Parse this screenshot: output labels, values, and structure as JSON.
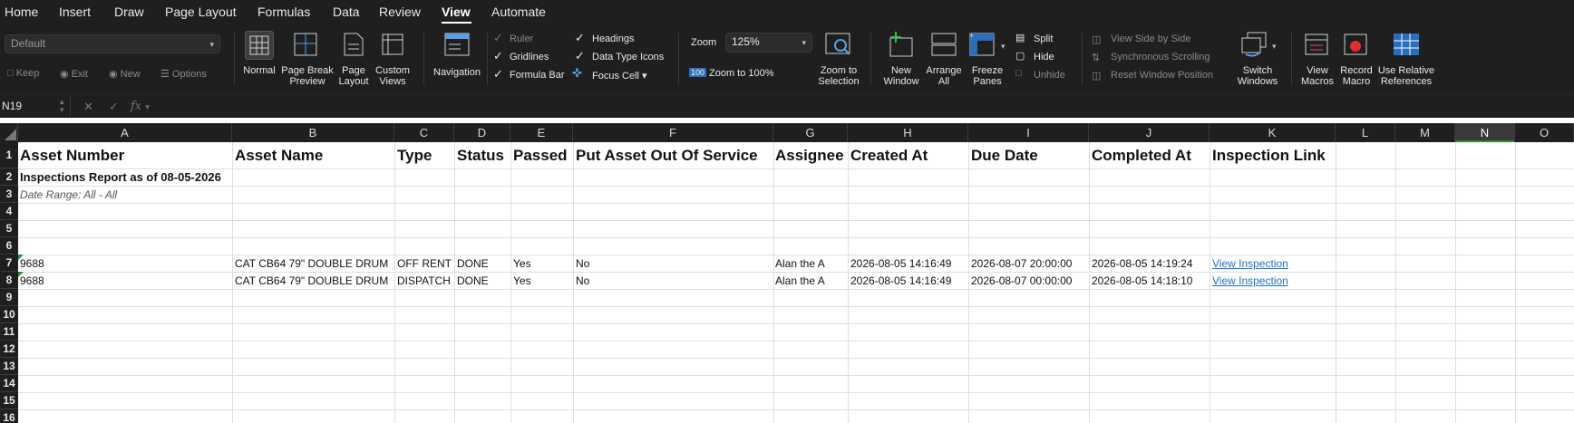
{
  "menu": {
    "tabs": [
      "Home",
      "Insert",
      "Draw",
      "Page Layout",
      "Formulas",
      "Data",
      "Review",
      "View",
      "Automate"
    ],
    "active": "View"
  },
  "ribbon": {
    "views_dropdown": "Default",
    "sheet_view_actions": [
      "Keep",
      "Exit",
      "New",
      "Options"
    ],
    "workbook_views": {
      "normal": "Normal",
      "page_break_1": "Page Break",
      "page_break_2": "Preview",
      "page_layout_1": "Page",
      "page_layout_2": "Layout",
      "custom_1": "Custom",
      "custom_2": "Views"
    },
    "navigation": "Navigation",
    "show": {
      "ruler": "Ruler",
      "gridlines": "Gridlines",
      "formula_bar": "Formula Bar",
      "headings": "Headings",
      "data_type_icons": "Data Type Icons",
      "focus_cell": "Focus Cell"
    },
    "zoom": {
      "label": "Zoom",
      "value": "125%",
      "zoom100": "Zoom to 100%",
      "badge": "100",
      "zoom_sel_1": "Zoom to",
      "zoom_sel_2": "Selection"
    },
    "window": {
      "new_1": "New",
      "new_2": "Window",
      "arrange_1": "Arrange",
      "arrange_2": "All",
      "freeze_1": "Freeze",
      "freeze_2": "Panes",
      "split": "Split",
      "hide": "Hide",
      "unhide": "Unhide"
    },
    "compare": {
      "side_by_side": "View Side by Side",
      "sync_scroll": "Synchronous Scrolling",
      "reset": "Reset Window Position"
    },
    "switch_1": "Switch",
    "switch_2": "Windows",
    "macros": {
      "view_1": "View",
      "view_2": "Macros",
      "record_1": "Record",
      "record_2": "Macro",
      "relative_1": "Use Relative",
      "relative_2": "References"
    }
  },
  "formula_bar": {
    "name_box": "N19",
    "fx": "fx",
    "value": ""
  },
  "grid": {
    "columns": [
      "A",
      "B",
      "C",
      "D",
      "E",
      "F",
      "G",
      "H",
      "I",
      "J",
      "K",
      "L",
      "M",
      "N",
      "O"
    ],
    "selected_column": "N",
    "rows": [
      "1",
      "2",
      "3",
      "4",
      "5",
      "6",
      "7",
      "8",
      "9",
      "10",
      "11",
      "12",
      "13",
      "14",
      "15",
      "16"
    ],
    "headers": [
      "Asset Number",
      "Asset Name",
      "Type",
      "Status",
      "Passed",
      "Put Asset Out Of Service",
      "Assignee",
      "Created At",
      "Due Date",
      "Completed At",
      "Inspection Link"
    ],
    "report_title": "Inspections Report as of 08-05-2026",
    "date_range": "Date Range: All - All",
    "records": [
      [
        "9688",
        "CAT CB64 79\" DOUBLE DRUM",
        "OFF RENT",
        "DONE",
        "Yes",
        "No",
        "Alan the A",
        "2026-08-05 14:16:49",
        "2026-08-07 20:00:00",
        "2026-08-05 14:19:24",
        "View Inspection"
      ],
      [
        "9688",
        "CAT CB64 79\" DOUBLE DRUM",
        "DISPATCH",
        "DONE",
        "Yes",
        "No",
        "Alan the A",
        "2026-08-05 14:16:49",
        "2026-08-07 00:00:00",
        "2026-08-05 14:18:10",
        "View Inspection"
      ]
    ]
  },
  "colors": {
    "ribbon_bg": "#1f1f1f",
    "link": "#1a73c9",
    "accent_green": "#2e8b3a"
  }
}
